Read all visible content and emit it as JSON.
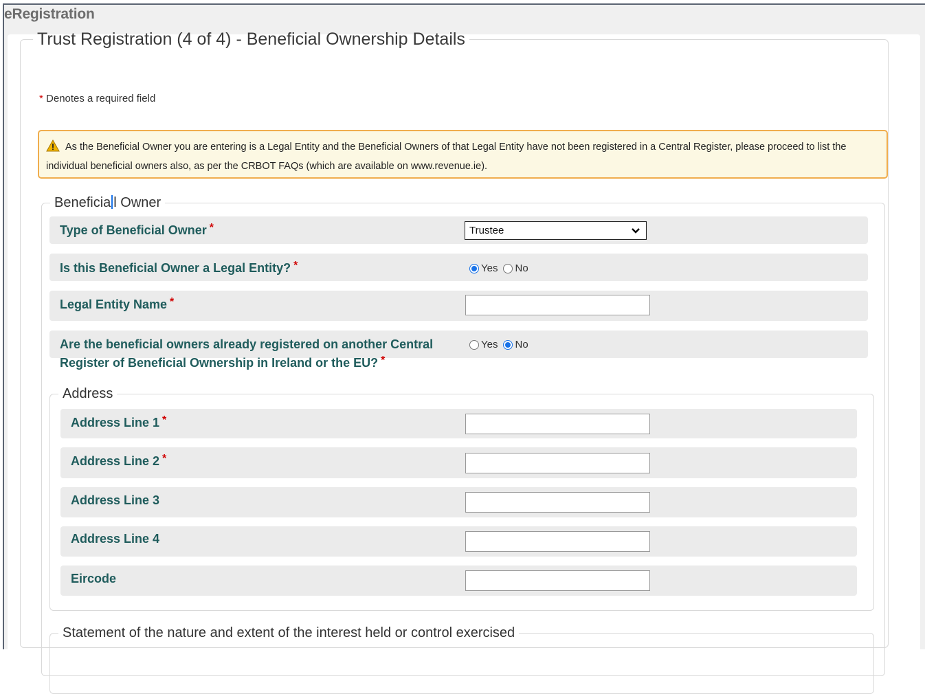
{
  "app": {
    "title": "eRegistration"
  },
  "form": {
    "title": "Trust Registration (4 of 4) - Beneficial Ownership Details",
    "required_note": "Denotes a required field",
    "required_star": "*"
  },
  "warning": {
    "icon": "warning-triangle-icon",
    "text": "As the Beneficial Owner you are entering is a Legal Entity and the Beneficial Owners of that Legal Entity have not been registered in a Central Register, please proceed to list the individual beneficial owners also, as per the CRBOT FAQs (which are available on www.revenue.ie)."
  },
  "beneficial_owner": {
    "legend_part1": "Beneficia",
    "legend_part2": "l Owner",
    "type_label": "Type of Beneficial Owner",
    "type_value": "Trustee",
    "legal_entity_label": "Is this Beneficial Owner a Legal Entity?",
    "legal_entity_options": [
      "Yes",
      "No"
    ],
    "legal_entity_selected": "Yes",
    "legal_entity_name_label": "Legal Entity Name",
    "legal_entity_name_value": "",
    "registered_label_line1": "Are the beneficial owners already registered on another Central",
    "registered_label_line2": "Register of Beneficial Ownership in Ireland or the EU?",
    "registered_options": [
      "Yes",
      "No"
    ],
    "registered_selected": "No"
  },
  "address": {
    "legend": "Address",
    "line1_label": "Address Line 1",
    "line2_label": "Address Line 2",
    "line3_label": "Address Line 3",
    "line4_label": "Address Line 4",
    "eircode_label": "Eircode",
    "line1_value": "",
    "line2_value": "",
    "line3_value": "",
    "line4_value": "",
    "eircode_value": ""
  },
  "statement": {
    "legend": "Statement of the nature and extent of the interest held or control exercised"
  },
  "colors": {
    "label": "#1f5c5c",
    "required": "#d00000",
    "warning_bg": "#fcf8e3",
    "warning_border": "#f0ad4e",
    "radio_selected": "#1a73e8"
  }
}
